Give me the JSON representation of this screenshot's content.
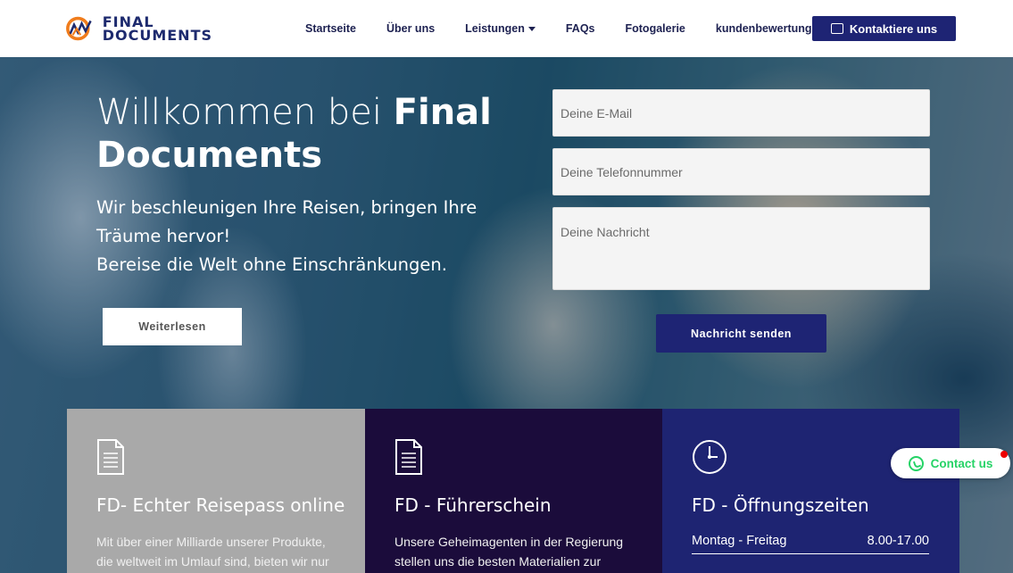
{
  "brand": {
    "logo_text_1": "FINAL",
    "logo_text_2": "DOCUMENTS"
  },
  "nav": {
    "items": [
      "Startseite",
      "Über uns",
      "Leistungen",
      "FAQs",
      "Fotogalerie",
      "kundenbewertungen"
    ],
    "contact_button": "Kontaktiere uns"
  },
  "hero": {
    "title_light": "Willkommen bei ",
    "title_bold": "Final Documents",
    "subtitle_line1": "Wir beschleunigen Ihre Reisen, bringen Ihre Träume hervor!",
    "subtitle_line2": "Bereise die Welt ohne Einschränkungen.",
    "read_more": "Weiterlesen"
  },
  "form": {
    "email_placeholder": "Deine E-Mail",
    "phone_placeholder": "Deine Telefonnummer",
    "message_placeholder": "Deine Nachricht",
    "send_button": "Nachricht senden"
  },
  "cards": [
    {
      "icon": "document-icon",
      "title": "FD- Echter Reisepass online",
      "text": "Mit über einer Milliarde unserer Produkte, die weltweit im Umlauf sind, bieten wir nur",
      "bg": "#a9a9a9"
    },
    {
      "icon": "document-icon",
      "title": "FD - Führerschein",
      "text": "Unsere Geheimagenten in der Regierung stellen uns die besten Materialien zur",
      "bg": "#1b0c3b"
    },
    {
      "icon": "clock-icon",
      "title": "FD - Öffnungszeiten",
      "hours_day": "Montag - Freitag",
      "hours_time": "8.00-17.00",
      "bg": "#1e2472"
    }
  ],
  "floating": {
    "contact_us": "Contact us"
  },
  "colors": {
    "primary": "#1e2474",
    "whatsapp": "#25d366"
  }
}
